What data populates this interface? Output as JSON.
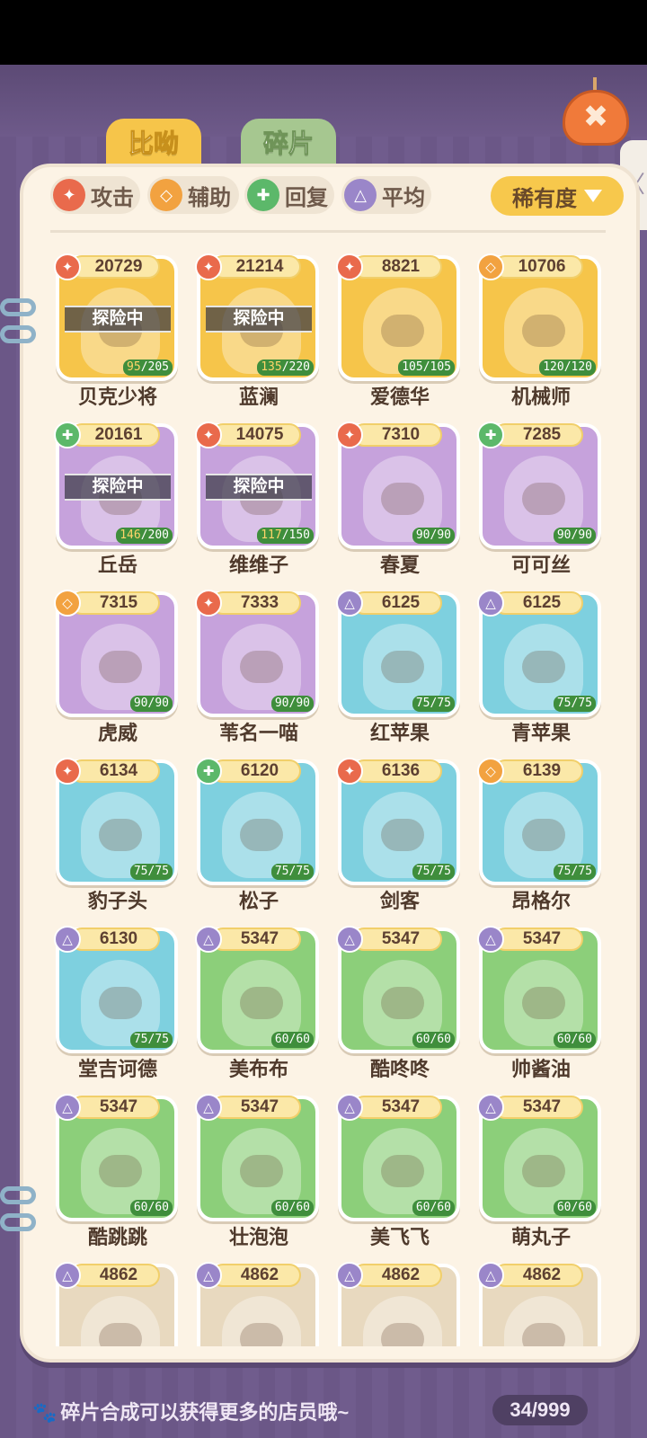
{
  "tabs": [
    {
      "label": "比呦",
      "active": true
    },
    {
      "label": "碎片",
      "active": false
    }
  ],
  "filters": [
    {
      "label": "攻击",
      "icon": "attack-icon",
      "color": "#e96a4c"
    },
    {
      "label": "辅助",
      "icon": "support-icon",
      "color": "#f2a240"
    },
    {
      "label": "回复",
      "icon": "heal-icon",
      "color": "#5cb86a"
    },
    {
      "label": "平均",
      "icon": "balanced-icon",
      "color": "#9a86c9"
    }
  ],
  "sort": {
    "label": "稀有度"
  },
  "mission_label": "探险中",
  "cards": [
    {
      "name": "贝克少将",
      "power": "20729",
      "type": "attack",
      "bg": "#f6c54a",
      "level": "95",
      "max": "205",
      "on_mission": true
    },
    {
      "name": "蓝澜",
      "power": "21214",
      "type": "attack",
      "bg": "#f6c54a",
      "level": "135",
      "max": "220",
      "on_mission": true
    },
    {
      "name": "爱德华",
      "power": "8821",
      "type": "attack",
      "bg": "#f6c54a",
      "level": "105",
      "max": "105",
      "on_mission": false
    },
    {
      "name": "机械师",
      "power": "10706",
      "type": "support",
      "bg": "#f6c54a",
      "level": "120",
      "max": "120",
      "on_mission": false
    },
    {
      "name": "丘岳",
      "power": "20161",
      "type": "heal",
      "bg": "#c6a2dc",
      "level": "146",
      "max": "200",
      "on_mission": true
    },
    {
      "name": "维维子",
      "power": "14075",
      "type": "attack",
      "bg": "#c6a2dc",
      "level": "117",
      "max": "150",
      "on_mission": true
    },
    {
      "name": "春夏",
      "power": "7310",
      "type": "attack",
      "bg": "#c6a2dc",
      "level": "90",
      "max": "90",
      "on_mission": false
    },
    {
      "name": "可可丝",
      "power": "7285",
      "type": "heal",
      "bg": "#c6a2dc",
      "level": "90",
      "max": "90",
      "on_mission": false
    },
    {
      "name": "虎威",
      "power": "7315",
      "type": "support",
      "bg": "#c6a2dc",
      "level": "90",
      "max": "90",
      "on_mission": false
    },
    {
      "name": "苇名一喵",
      "power": "7333",
      "type": "attack",
      "bg": "#c6a2dc",
      "level": "90",
      "max": "90",
      "on_mission": false
    },
    {
      "name": "红苹果",
      "power": "6125",
      "type": "balanced",
      "bg": "#7ed0df",
      "level": "75",
      "max": "75",
      "on_mission": false
    },
    {
      "name": "青苹果",
      "power": "6125",
      "type": "balanced",
      "bg": "#7ed0df",
      "level": "75",
      "max": "75",
      "on_mission": false
    },
    {
      "name": "豹子头",
      "power": "6134",
      "type": "attack",
      "bg": "#7ed0df",
      "level": "75",
      "max": "75",
      "on_mission": false
    },
    {
      "name": "松子",
      "power": "6120",
      "type": "heal",
      "bg": "#7ed0df",
      "level": "75",
      "max": "75",
      "on_mission": false
    },
    {
      "name": "剑客",
      "power": "6136",
      "type": "attack",
      "bg": "#7ed0df",
      "level": "75",
      "max": "75",
      "on_mission": false
    },
    {
      "name": "昂格尔",
      "power": "6139",
      "type": "support",
      "bg": "#7ed0df",
      "level": "75",
      "max": "75",
      "on_mission": false
    },
    {
      "name": "堂吉诃德",
      "power": "6130",
      "type": "balanced",
      "bg": "#7ed0df",
      "level": "75",
      "max": "75",
      "on_mission": false
    },
    {
      "name": "美布布",
      "power": "5347",
      "type": "balanced",
      "bg": "#8ccf7a",
      "level": "60",
      "max": "60",
      "on_mission": false
    },
    {
      "name": "酷咚咚",
      "power": "5347",
      "type": "balanced",
      "bg": "#8ccf7a",
      "level": "60",
      "max": "60",
      "on_mission": false
    },
    {
      "name": "帅酱油",
      "power": "5347",
      "type": "balanced",
      "bg": "#8ccf7a",
      "level": "60",
      "max": "60",
      "on_mission": false
    },
    {
      "name": "酷跳跳",
      "power": "5347",
      "type": "balanced",
      "bg": "#8ccf7a",
      "level": "60",
      "max": "60",
      "on_mission": false
    },
    {
      "name": "壮泡泡",
      "power": "5347",
      "type": "balanced",
      "bg": "#8ccf7a",
      "level": "60",
      "max": "60",
      "on_mission": false
    },
    {
      "name": "美飞飞",
      "power": "5347",
      "type": "balanced",
      "bg": "#8ccf7a",
      "level": "60",
      "max": "60",
      "on_mission": false
    },
    {
      "name": "萌丸子",
      "power": "5347",
      "type": "balanced",
      "bg": "#8ccf7a",
      "level": "60",
      "max": "60",
      "on_mission": false
    },
    {
      "name": "",
      "power": "4862",
      "type": "balanced",
      "bg": "#e8d9bf",
      "level": "",
      "max": "",
      "on_mission": false
    },
    {
      "name": "",
      "power": "4862",
      "type": "balanced",
      "bg": "#e8d9bf",
      "level": "",
      "max": "",
      "on_mission": false
    },
    {
      "name": "",
      "power": "4862",
      "type": "balanced",
      "bg": "#e8d9bf",
      "level": "",
      "max": "",
      "on_mission": false
    },
    {
      "name": "",
      "power": "4862",
      "type": "balanced",
      "bg": "#e8d9bf",
      "level": "",
      "max": "",
      "on_mission": false
    }
  ],
  "type_colors": {
    "attack": "#e96a4c",
    "support": "#f2a240",
    "heal": "#5cb86a",
    "balanced": "#9a86c9"
  },
  "footer": {
    "hint": "碎片合成可以获得更多的店员哦~",
    "count": "34/999"
  }
}
